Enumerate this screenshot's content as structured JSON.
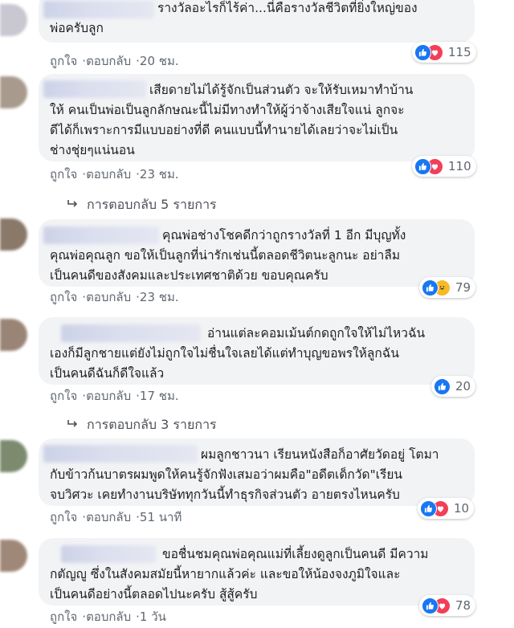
{
  "comments": [
    {
      "text": "รางวัลอะไรก็ไร้ค่า...นี่คือรางวัลชีวิตที่ยิ่งใหญ่ของ\nพ่อครับลูก",
      "like_label": "ถูกใจ",
      "reply_label": "ตอบกลับ",
      "time": "20 ชม.",
      "reactions": [
        "like",
        "love"
      ],
      "count": "115",
      "avatar_color": "#c9c8d2"
    },
    {
      "text": "เสียดายไม่ได้รู้จักเป็นส่วนตัว จะให้รับเหมาทำบ้าน\nให้ คนเป็นพ่อเป็นลูกลักษณะนี้ไม่มีทางทำให้ผู้ว่าจ้างเสียใจแน่ ลูกจะ\nดีได้ก็เพราะการมีแบบอย่างที่ดี คนแบบนี้ทำนายได้เลยว่าจะไม่เป็น\nช่างชุ่ยๆแน่นอน",
      "like_label": "ถูกใจ",
      "reply_label": "ตอบกลับ",
      "time": "23 ชม.",
      "reactions": [
        "like",
        "love"
      ],
      "count": "110",
      "avatar_color": "#a89a8c"
    },
    {
      "text": "คุณพ่อช่างโชคดีกว่าถูกรางวัลที่ 1 อีก มีบุญทั้ง\nคุณพ่อคุณลูก ขอให้เป็นลูกที่น่ารักเช่นนี้ตลอดชีวิตนะลูกนะ อย่าลืม\nเป็นคนดีของสังคมและประเทศชาติด้วย ขอบคุณครับ",
      "like_label": "ถูกใจ",
      "reply_label": "ตอบกลับ",
      "time": "23 ชม.",
      "reactions": [
        "like",
        "haha"
      ],
      "count": "79",
      "avatar_color": "#8a7868"
    },
    {
      "text": "อ่านแต่ละคอมเม้นต์กดถูกใจให้ไม่ไหวฉัน\nเองก็มีลูกชายแต่ยังไม่ถูกใจไม่ชื่นใจเลยได้แต่ทำบุญขอพรให้ลูกฉัน\nเป็นคนดีฉันก็ดีใจแล้ว",
      "like_label": "ถูกใจ",
      "reply_label": "ตอบกลับ",
      "time": "17 ชม.",
      "reactions": [
        "like"
      ],
      "count": "20",
      "avatar_color": "#9a8476"
    },
    {
      "text": "ผมลูกชาวนา เรียนหนังสือก็อาศัยวัดอยู่ โตมา\nกับข้าวก้นบาตรผมพูดให้คนรู้จักฟังเสมอว่าผมคือ\"อดีตเด็กวัด\"เรียน\nจบวิศวะ เคยทำงานบริษัททุกวันนี้ทำธุรกิจส่วนตัว อายตรงไหนครับ",
      "like_label": "ถูกใจ",
      "reply_label": "ตอบกลับ",
      "time": "51 นาที",
      "reactions": [
        "like",
        "love"
      ],
      "count": "10",
      "avatar_color": "#7c8a6e"
    },
    {
      "text": "ขอชื่นชมคุณพ่อคุณแม่ที่เลี้ยงดูลูกเป็นคนดี มีความ\nกตัญญู ซึ่งในสังคมสมัยนี้หายากแล้วค่ะ และขอให้น้องจงภูมิใจและ\nเป็นคนดีอย่างนี้ตลอดไปนะครับ สู้สู้ครับ",
      "like_label": "ถูกใจ",
      "reply_label": "ตอบกลับ",
      "time": "1 วัน",
      "reactions": [
        "like",
        "love"
      ],
      "count": "78",
      "avatar_color": "#a08878"
    }
  ],
  "replies": [
    {
      "label": "การตอบกลับ 5 รายการ"
    },
    {
      "label": "การตอบกลับ 3 รายการ"
    }
  ],
  "separator": "·"
}
